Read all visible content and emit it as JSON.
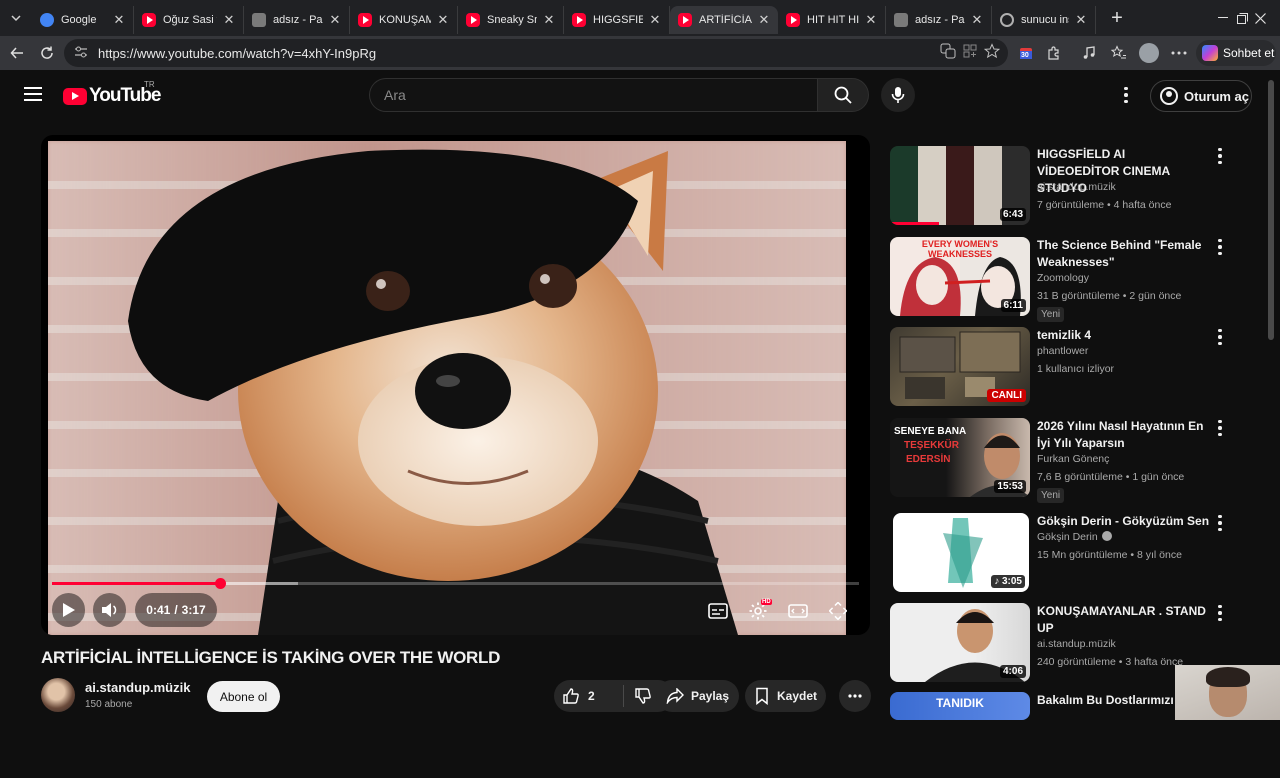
{
  "browser": {
    "tabs": [
      {
        "label": "Google",
        "icon": "google"
      },
      {
        "label": "Oğuz Sasi vs",
        "icon": "yt"
      },
      {
        "label": "adsız - Paint",
        "icon": "paint"
      },
      {
        "label": "KONUŞAMAY",
        "icon": "yt"
      },
      {
        "label": "Sneaky Snitc",
        "icon": "yt"
      },
      {
        "label": "HIGGSFIELD /",
        "icon": "yt"
      },
      {
        "label": "ARTİFİCİAL İN",
        "icon": "yt"
      },
      {
        "label": "HIT HIT HIT N",
        "icon": "yt"
      },
      {
        "label": "adsız - Paint",
        "icon": "paint"
      },
      {
        "label": "sunucu insan",
        "icon": "globe"
      }
    ],
    "url": "https://www.youtube.com/watch?v=4xhY-In9pRg",
    "copilot_label": "Sohbet et",
    "extension_badge": "30"
  },
  "youtube": {
    "logo_text": "YouTube",
    "country_code": "TR",
    "search_placeholder": "Ara",
    "signin_label": "Oturum aç"
  },
  "player": {
    "time_current": "0:41",
    "time_total": "3:17",
    "progress_fraction": 0.208,
    "buffer_fraction": 0.305,
    "hd_badge": "HD",
    "accent": "#ff0033"
  },
  "video": {
    "title": "ARTİFİCİAL İNTELLİGENCE İS TAKİNG OVER THE WORLD",
    "channel": "ai.standup.müzik",
    "subscribers": "150 abone",
    "subscribe_label": "Abone ol",
    "like_count": "2",
    "share_label": "Paylaş",
    "save_label": "Kaydet"
  },
  "recommendations": [
    {
      "title": "HIGGSFİELD AI  VİDEOEDİTOR CINEMA STUDYO",
      "channel": "ai.standup.müzik",
      "meta": "7 görüntüleme • 4 hafta önce",
      "duration": "6:43",
      "badge": "",
      "verified": false,
      "watched": 0.35
    },
    {
      "title": "The Science Behind \"Female Weaknesses\"",
      "channel": "Zoomology",
      "meta": "31 B görüntüleme • 2 gün önce",
      "duration": "6:11",
      "badge": "Yeni",
      "verified": false,
      "watched": 0,
      "thumb_text": "EVERY WOMEN'S WEAKNESSES"
    },
    {
      "title": "temizlik 4",
      "channel": "phantlower",
      "meta": "1 kullanıcı izliyor",
      "duration": "",
      "live": "CANLI",
      "badge": "",
      "verified": false,
      "watched": 0
    },
    {
      "title": "2026 Yılını Nasıl Hayatının En İyi Yılı Yaparsın",
      "channel": "Furkan Gönenç",
      "meta": "7,6 B görüntüleme • 1 gün önce",
      "duration": "15:53",
      "badge": "Yeni",
      "verified": false,
      "watched": 0,
      "thumb_text_1": "SENEYE BANA",
      "thumb_text_2": "TEŞEKKÜR",
      "thumb_text_3": "EDERSİN"
    },
    {
      "title": "Gökşin Derin - Gökyüzüm Sen",
      "channel": "Gökşin Derin",
      "meta": "15 Mn görüntüleme • 8 yıl önce",
      "duration": "♪ 3:05",
      "badge": "",
      "verified": true,
      "watched": 0
    },
    {
      "title": "KONUŞAMAYANLAR . STAND UP",
      "channel": "ai.standup.müzik",
      "meta": "240 görüntüleme • 3 hafta önce",
      "duration": "4:06",
      "badge": "",
      "verified": false,
      "watched": 0
    },
    {
      "title": "Bakalım Bu Dostlarımızı",
      "channel": "",
      "meta": "",
      "duration": "",
      "badge": "",
      "verified": false,
      "watched": 0,
      "thumb_text": "TANIDIK"
    }
  ]
}
